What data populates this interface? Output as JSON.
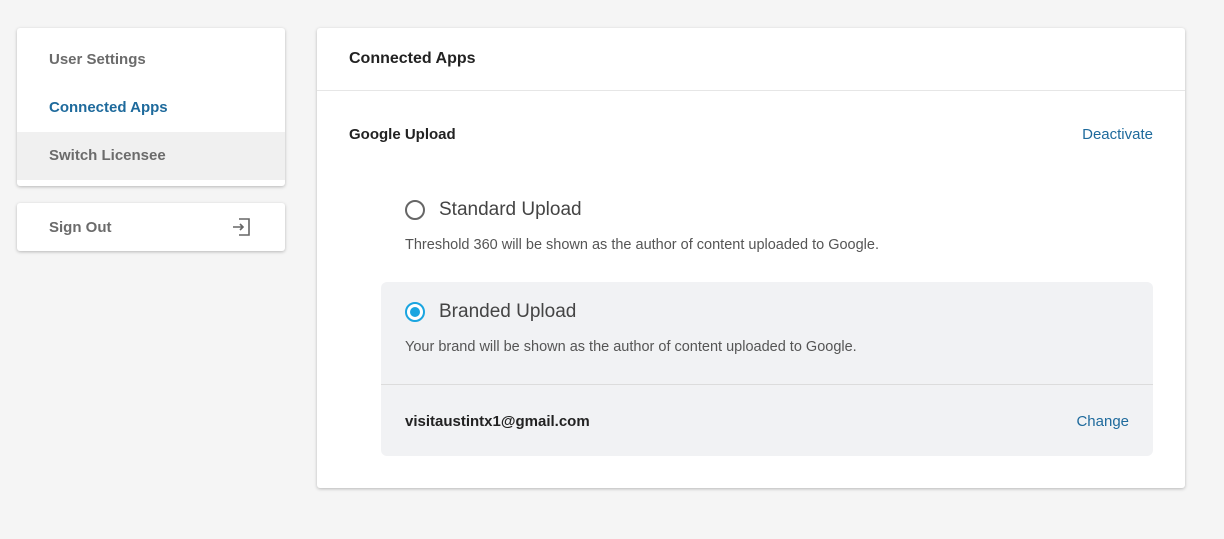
{
  "sidebar": {
    "items": [
      {
        "label": "User Settings"
      },
      {
        "label": "Connected Apps"
      },
      {
        "label": "Switch Licensee"
      }
    ],
    "sign_out_label": "Sign Out",
    "sign_out_icon": "sign-out-icon"
  },
  "main": {
    "title": "Connected Apps",
    "app": {
      "name": "Google Upload",
      "deactivate_label": "Deactivate"
    },
    "options": {
      "standard": {
        "title": "Standard Upload",
        "description": "Threshold 360 will be shown as the author of content uploaded to Google.",
        "selected": false
      },
      "branded": {
        "title": "Branded Upload",
        "description": "Your brand will be shown as the author of content uploaded to Google.",
        "selected": true,
        "account_email": "visitaustintx1@gmail.com",
        "change_label": "Change"
      }
    }
  },
  "colors": {
    "link": "#1e6a9c",
    "radio_selected": "#1aa5e0",
    "background": "#f5f5f5"
  }
}
